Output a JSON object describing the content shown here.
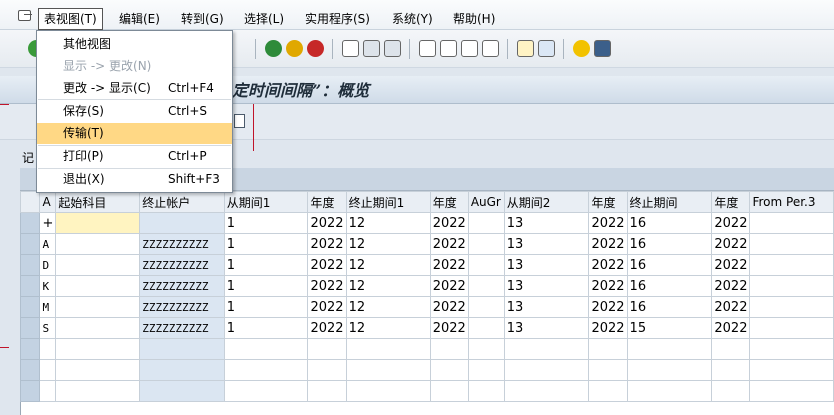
{
  "menubar": {
    "items": [
      "表视图(T)",
      "编辑(E)",
      "转到(G)",
      "选择(L)",
      "实用程序(S)",
      "系统(Y)",
      "帮助(H)"
    ]
  },
  "title": {
    "text": "定时间间隔”：概览"
  },
  "record_label": "记",
  "dropdown": {
    "items": [
      {
        "label": "其他视图",
        "shortcut": ""
      },
      {
        "label": "显示 -> 更改(N)",
        "shortcut": ""
      },
      {
        "label": "更改 -> 显示(C)",
        "shortcut": "Ctrl+F4"
      },
      {
        "label": "保存(S)",
        "shortcut": "Ctrl+S"
      },
      {
        "label": "传输(T)",
        "shortcut": ""
      },
      {
        "label": "打印(P)",
        "shortcut": "Ctrl+P"
      },
      {
        "label": "退出(X)",
        "shortcut": "Shift+F3"
      }
    ]
  },
  "table": {
    "headers": [
      "A",
      "起始科目",
      "终止帐户",
      "从期间1",
      "年度",
      "终止期间1",
      "年度",
      "AuGr",
      "从期间2",
      "年度",
      "终止期间",
      "年度",
      "From Per.3"
    ],
    "rows": [
      [
        "+",
        "",
        "",
        "1",
        "2022",
        "12",
        "2022",
        "",
        "13",
        "2022",
        "16",
        "2022",
        ""
      ],
      [
        "A",
        "",
        "ZZZZZZZZZZ",
        "1",
        "2022",
        "12",
        "2022",
        "",
        "13",
        "2022",
        "16",
        "2022",
        ""
      ],
      [
        "D",
        "",
        "ZZZZZZZZZZ",
        "1",
        "2022",
        "12",
        "2022",
        "",
        "13",
        "2022",
        "16",
        "2022",
        ""
      ],
      [
        "K",
        "",
        "ZZZZZZZZZZ",
        "1",
        "2022",
        "12",
        "2022",
        "",
        "13",
        "2022",
        "16",
        "2022",
        ""
      ],
      [
        "M",
        "",
        "ZZZZZZZZZZ",
        "1",
        "2022",
        "12",
        "2022",
        "",
        "13",
        "2022",
        "16",
        "2022",
        ""
      ],
      [
        "S",
        "",
        "ZZZZZZZZZZ",
        "1",
        "2022",
        "12",
        "2022",
        "",
        "13",
        "2022",
        "15",
        "2022",
        ""
      ]
    ]
  }
}
